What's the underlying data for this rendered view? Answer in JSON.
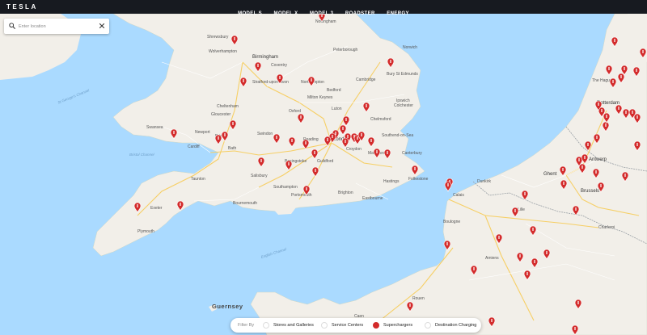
{
  "brand": {
    "logo_text": "TESLA"
  },
  "nav": {
    "items": [
      "MODEL S",
      "MODEL X",
      "MODEL 3",
      "ROADSTER",
      "ENERGY"
    ]
  },
  "search": {
    "placeholder": "Enter location",
    "value": ""
  },
  "filters": {
    "label": "Filter By",
    "items": [
      {
        "label": "Stores and Galleries",
        "active": false
      },
      {
        "label": "Service Centers",
        "active": false
      },
      {
        "label": "Superchargers",
        "active": true
      },
      {
        "label": "Destination Charging",
        "active": false
      }
    ]
  },
  "colors": {
    "water": "#aadaff",
    "land": "#f2efe9",
    "pin": "#d32b2b",
    "nav_bg": "#171a20"
  },
  "map_labels": {
    "cities": [
      "Shrewsbury",
      "Wolverhampton",
      "Birmingham",
      "Coventry",
      "Nottingham",
      "Peterborough",
      "Norwich",
      "Northampton",
      "Cambridge",
      "Bury St Edmunds",
      "Stratford-upon-Avon",
      "Milton Keynes",
      "Bedford",
      "Ipswich",
      "Oxford",
      "Luton",
      "Colchester",
      "Cheltenham",
      "Gloucester",
      "Chelmsford",
      "London",
      "Southend-on-Sea",
      "Swansea",
      "Newport",
      "Cardiff",
      "Bristol",
      "Bath",
      "Swindon",
      "Reading",
      "Croydon",
      "Maidstone",
      "Canterbury",
      "Guildford",
      "Basingstoke",
      "Salisbury",
      "Taunton",
      "Exeter",
      "Southampton",
      "Portsmouth",
      "Brighton",
      "Eastbourne",
      "Hastings",
      "Folkestone",
      "Plymouth",
      "Bournemouth",
      "Dunkirk",
      "Calais",
      "Boulogne",
      "Lille",
      "Ghent",
      "Antwerp",
      "Brussels",
      "Rotterdam",
      "The Hague",
      "Amiens",
      "Caen",
      "Rouen",
      "Charleroi"
    ],
    "seas": [
      "Bristol Channel",
      "St George's Channel",
      "English Channel"
    ],
    "islands": [
      "Guernsey"
    ]
  },
  "map_pins": 90
}
